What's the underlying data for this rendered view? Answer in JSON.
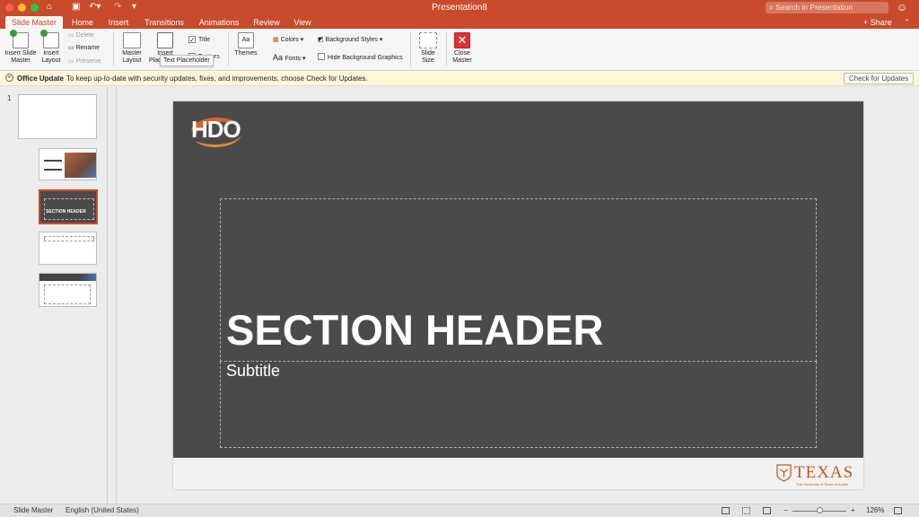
{
  "titlebar": {
    "document_title": "Presentation8",
    "search_placeholder": "Search in Presentation"
  },
  "tabs": [
    {
      "label": "Slide Master",
      "active": true
    },
    {
      "label": "Home"
    },
    {
      "label": "Insert"
    },
    {
      "label": "Transitions"
    },
    {
      "label": "Animations"
    },
    {
      "label": "Review"
    },
    {
      "label": "View"
    }
  ],
  "share_label": "Share",
  "ribbon": {
    "insert_slide_master": "Insert Slide\nMaster",
    "insert_layout": "Insert\nLayout",
    "delete": "Delete",
    "rename": "Rename",
    "preserve": "Preserve",
    "master_layout": "Master\nLayout",
    "insert_placeholder": "Insert\nPlaceholder",
    "title_check": "Title",
    "footers_check": "Footers",
    "themes": "Themes",
    "colors": "Colors",
    "fonts": "Fonts",
    "background_styles": "Background Styles",
    "hide_background_graphics": "Hide Background Graphics",
    "slide_size": "Slide\nSize",
    "close_master": "Close\nMaster",
    "tooltip": "Text Placeholder"
  },
  "message_bar": {
    "title": "Office Update",
    "text": "To keep up-to-date with security updates, fixes, and improvements, choose Check for Updates.",
    "button": "Check for Updates"
  },
  "thumbnails": {
    "number": "1",
    "selected_index": 2
  },
  "slide": {
    "logo_text": "HDO",
    "title": "SECTION HEADER",
    "subtitle": "Subtitle",
    "footer_logo": "TEXAS",
    "footer_logo_sub": "The University of Texas at Austin"
  },
  "statusbar": {
    "view_name": "Slide Master",
    "language": "English (United States)",
    "zoom": "126%"
  },
  "colors": {
    "accent": "#c84b2b",
    "slide_bg": "#4a4a4a",
    "texas_orange": "#c0582b"
  }
}
